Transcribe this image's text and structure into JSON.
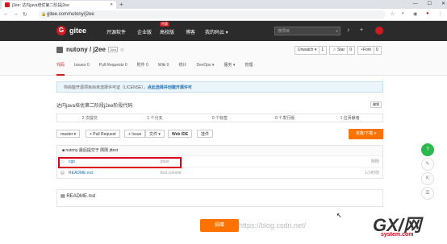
{
  "browser": {
    "tab_title": "j2ee: 达内java培优第二阶段j2ee",
    "url": "gitee.com/nutony/j2ee"
  },
  "gitee_nav": {
    "logo_text": "gitee",
    "items": [
      "开源软件",
      "企业版",
      "高校版",
      "博客",
      "我的码云 ▾"
    ],
    "badge": "特惠",
    "search_placeholder": "搜项目"
  },
  "repo": {
    "owner_name": "nutony / j2ee",
    "lang_badge": "Java",
    "unwatch": "Unwatch ▾",
    "unwatch_count": "1",
    "star": "☆ Star",
    "star_count": "0",
    "fork": "Fork",
    "fork_count": "0",
    "tabs": [
      "代码",
      "Issues 0",
      "Pull Requests 0",
      "附件 0",
      "Wiki 0",
      "统计",
      "DevOps ▾",
      "服务 ▾",
      "管理"
    ]
  },
  "notice": {
    "text": "你尚能开源项目尚未选择许可证（LICENSE），",
    "link": "点此选择并创建开源许可"
  },
  "description": "达内java培优第二阶段j2ee阶段代码",
  "edit_label": "编辑",
  "stats": [
    "2 次提交",
    "1 个分支",
    "0 个标签",
    "0 个发行版",
    "1 位贡献者"
  ],
  "toolbar": {
    "branch": "master ▾",
    "pull_request": "+ Pull Request",
    "issue": "+ Issue",
    "file": "文件 ▾",
    "web_ide": "Web IDE",
    "attach": "挂件",
    "clone": "克隆/下载 ▾"
  },
  "commit_bar": "nutony 最后提交于 刚刚 jttest",
  "files": [
    {
      "name": "cgb",
      "msg": "jttest",
      "time": "刚刚"
    },
    {
      "name": "README.md",
      "msg": "first commit",
      "time": "1小时前"
    }
  ],
  "readme_title": "README.md",
  "donate": "捐赠",
  "watermark": "https://blog.csdn.net/",
  "gxi": {
    "logo": "GX/网",
    "sub": "system.com"
  }
}
